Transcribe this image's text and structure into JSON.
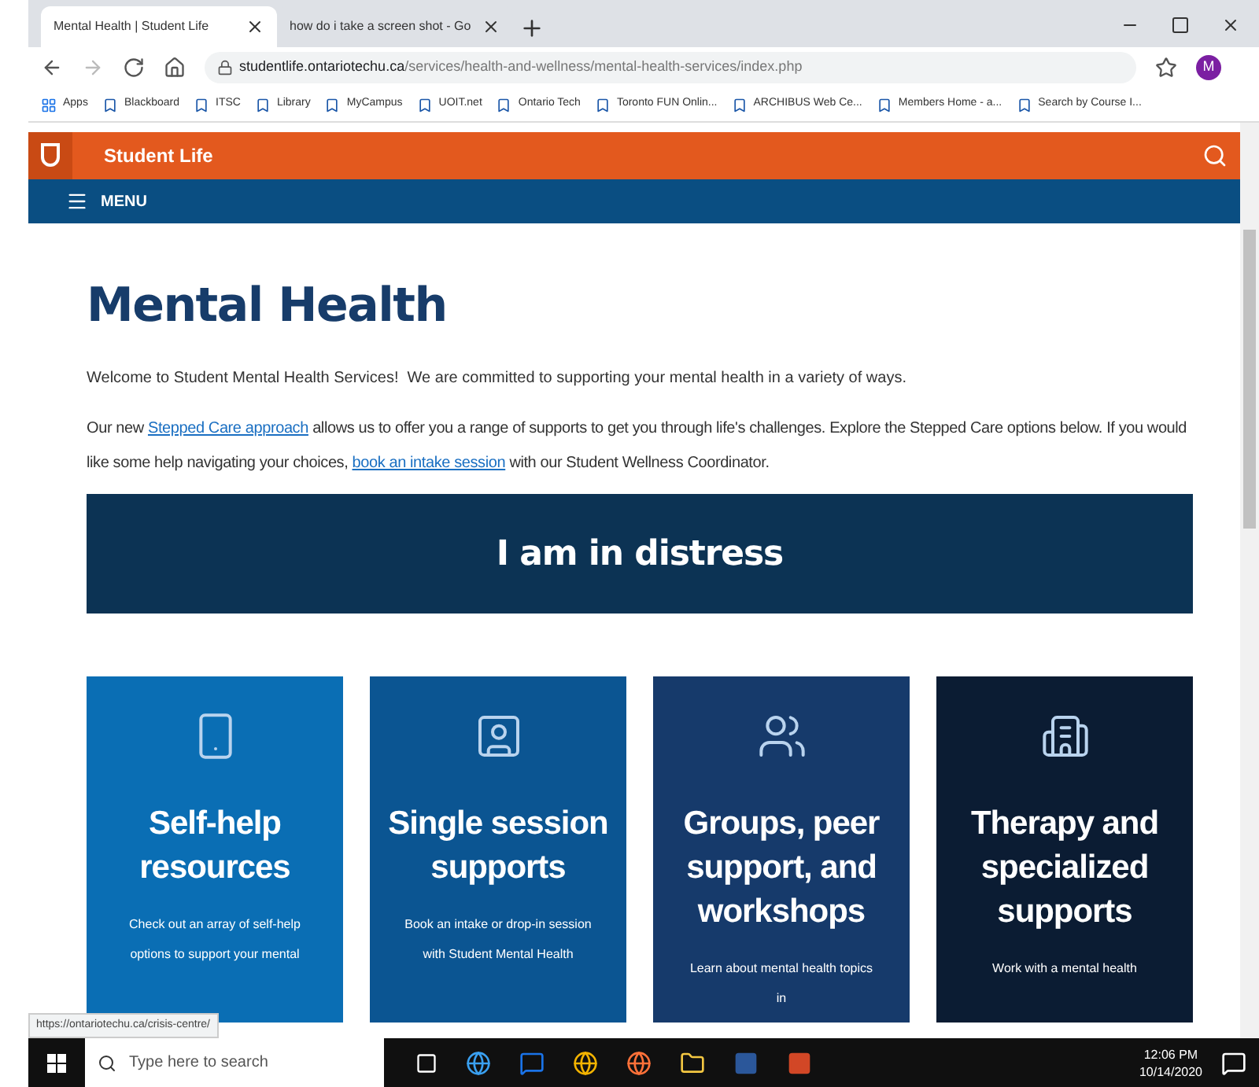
{
  "browser": {
    "tabs": [
      {
        "title": "Mental Health | Student Life",
        "selected": true
      },
      {
        "title": "how do i take a screen shot - Go",
        "selected": false
      }
    ],
    "address": {
      "domain": "studentlife.ontariotechu.ca",
      "path": "/services/health-and-wellness/mental-health-services/index.php"
    },
    "profile_initial": "M",
    "bookmarks": [
      "Apps",
      "Blackboard",
      "ITSC",
      "Library",
      "MyCampus",
      "UOIT.net",
      "Ontario Tech",
      "Toronto FUN Onlin...",
      "ARCHIBUS Web Ce...",
      "Members Home - a...",
      "Search by Course I..."
    ]
  },
  "site": {
    "title": "Student Life",
    "menu": "MENU"
  },
  "page": {
    "heading": "Mental Health",
    "intro": "Welcome to Student Mental Health Services!  We are committed to supporting your mental health in a variety of ways.",
    "paragraph": [
      {
        "kind": "text",
        "text": "Our new "
      },
      {
        "kind": "link",
        "text": "Stepped Care approach"
      },
      {
        "kind": "text",
        "text": " allows us to offer you a range of supports to get you through life's challenges. Explore the Stepped Care options below. If you would like some help navigating your choices, "
      },
      {
        "kind": "link",
        "text": "book an intake session"
      },
      {
        "kind": "text",
        "text": " with our Student Wellness Coordinator."
      }
    ],
    "banner": "I am in distress",
    "cards": [
      {
        "kind": "phone",
        "title": "Self-help resources",
        "text": "Check out an array of self-help options to support your mental",
        "color": "#0a6eb4"
      },
      {
        "kind": "person",
        "title": "Single session supports",
        "text": "Book an intake or drop-in session with Student Mental Health",
        "color": "#0b5592"
      },
      {
        "kind": "group",
        "title": "Groups, peer support, and workshops",
        "text": "Learn about mental health topics in",
        "color": "#163a6b"
      },
      {
        "kind": "building",
        "title": "Therapy and specialized supports",
        "text": "Work with a mental health",
        "color": "#0b1c33"
      }
    ]
  },
  "status_url": "https://ontariotechu.ca/crisis-centre/",
  "taskbar": {
    "search_placeholder": "Type here to search",
    "time": "12:06 PM",
    "date": "10/14/2020"
  }
}
